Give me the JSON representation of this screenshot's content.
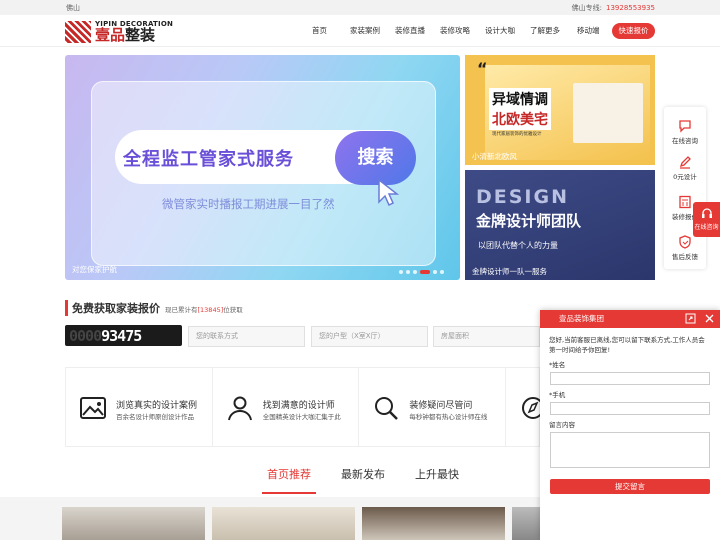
{
  "topbar": {
    "city": "佛山",
    "hotline_city": "佛山专线:",
    "hotline_number": "13928553935"
  },
  "logo": {
    "en": "YIPIN DECORATION",
    "cn_part1": "壹品",
    "cn_part2": "整装"
  },
  "nav": {
    "items": [
      "首页",
      "家装案例",
      "装修直播",
      "装修攻略",
      "设计大咖",
      "了解更多",
      "移动端"
    ],
    "cta": "快速报价"
  },
  "banner": {
    "headline": "全程监工管家式服务",
    "search_label": "搜索",
    "subline": "微管家实时播报工期进展一目了然",
    "caption": "对您保家护航",
    "slides": 6,
    "active_slide": 3
  },
  "card1": {
    "quote": "“",
    "title1": "异域情调",
    "title2": "北欧美宅",
    "tiny": "现代家居装饰的优雅设计",
    "caption": "小清新北欧风"
  },
  "card2": {
    "design": "DESIGN",
    "title": "金牌设计师团队",
    "sub": "以团队代替个人的力量",
    "caption": "金牌设计师一队一服务"
  },
  "sidebar": {
    "items": [
      {
        "label": "在线咨询",
        "icon": "chat-icon"
      },
      {
        "label": "0元设计",
        "icon": "pencil-icon"
      },
      {
        "label": "装修报价",
        "icon": "calculator-icon"
      },
      {
        "label": "售后反馈",
        "icon": "shield-icon"
      }
    ],
    "online": "在线咨询"
  },
  "quote_section": {
    "title": "免费获取家装报价",
    "sub_prefix": "现已累计有",
    "sub_count": "[13845]",
    "sub_suffix": "位获取",
    "counter_dim": "0000",
    "counter_value": "93475",
    "field_contact": "您的联系方式",
    "field_house": "您的户型（X室X厅）",
    "field_area": "房屋面积"
  },
  "features": [
    {
      "title": "浏览真实的设计案例",
      "desc": "百余名设计师原创设计作品",
      "icon": "image-icon"
    },
    {
      "title": "找到满意的设计师",
      "desc": "全国精英设计大咖汇集于此",
      "icon": "user-icon"
    },
    {
      "title": "装修疑问尽管问",
      "desc": "每秒钟都有热心设计师在线",
      "icon": "search-icon"
    },
    {
      "title": "",
      "desc": "",
      "icon": "compass-icon"
    }
  ],
  "tabs": [
    "首页推荐",
    "最新发布",
    "上升最快"
  ],
  "chat": {
    "title": "壹品装饰集团",
    "message": "您好,当前客服已离线,您可以留下联系方式,工作人员会第一时间给予你回复!",
    "name_label": "*姓名",
    "phone_label": "*手机",
    "msg_label": "留言内容",
    "submit": "提交留言"
  },
  "colors": {
    "accent": "#e53935",
    "dark": "#1b1b1b"
  }
}
